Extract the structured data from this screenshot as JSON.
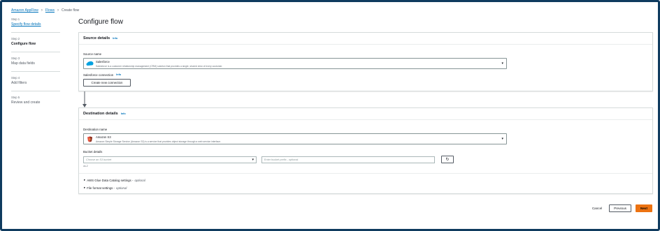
{
  "breadcrumb": {
    "root": "Amazon AppFlow",
    "flows": "Flows",
    "current": "Create flow"
  },
  "steps": [
    {
      "num": "Step 1",
      "label": "Specify flow details",
      "state": "link"
    },
    {
      "num": "Step 2",
      "label": "Configure flow",
      "state": "active"
    },
    {
      "num": "Step 3",
      "label": "Map data fields",
      "state": "pending"
    },
    {
      "num": "Step 4",
      "label": "Add filters",
      "state": "pending"
    },
    {
      "num": "Step 5",
      "label": "Review and create",
      "state": "pending"
    }
  ],
  "page_title": "Configure flow",
  "source": {
    "heading": "Source details",
    "info": "Info",
    "name_label": "Source name",
    "selected_title": "Salesforce",
    "selected_desc": "Salesforce is a customer relationship management (CRM) solution that provides a single, shared view of every customer.",
    "connection_label": "Salesforce connection",
    "connection_info": "Info",
    "create_connection_button": "Create new connection",
    "logo_icon": "salesforce-cloud-icon"
  },
  "destination": {
    "heading": "Destination details",
    "info": "Info",
    "name_label": "Destination name",
    "selected_title": "Amazon S3",
    "selected_desc": "Amazon Simple Storage Service (Amazon S3) is a service that provides object storage through a web service interface.",
    "bucket_label": "Bucket details",
    "bucket_placeholder": "Choose an S3 bucket",
    "prefix_placeholder": "Enter bucket prefix - optional",
    "region_hint": "us-2",
    "refresh_icon": "refresh-icon",
    "logo_icon": "amazon-s3-bucket-icon",
    "glue_label": "AWS Glue Data Catalog settings -",
    "glue_optional": "optional",
    "format_label": "File format settings -",
    "format_optional": "optional"
  },
  "footer": {
    "cancel": "Cancel",
    "previous": "Previous",
    "next": "Next"
  },
  "colors": {
    "link": "#0073bb",
    "primary_button": "#ec7211",
    "frame_border": "#0f3b5f"
  }
}
